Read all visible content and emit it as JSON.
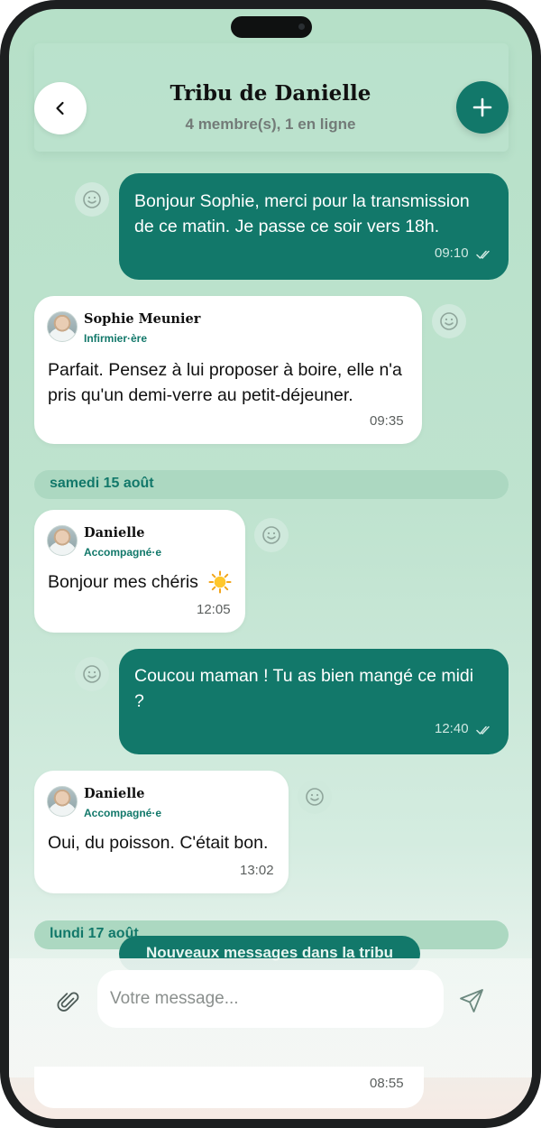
{
  "header": {
    "title": "Tribu de Danielle",
    "subtitle": "4 membre(s), 1 en ligne",
    "back_icon": "chevron-left-icon",
    "add_icon": "plus-icon"
  },
  "messages": [
    {
      "direction": "out",
      "text_lines": [
        "Bonjour Sophie, merci pour la transmission",
        "de ce matin. Je passe ce soir vers 18h."
      ],
      "time": "09:10",
      "read": true
    },
    {
      "direction": "in",
      "sender": "Sophie Meunier",
      "role": "Infirmier·ère",
      "text_lines": [
        "Parfait. Pensez à lui proposer à boire, elle n'a",
        "pris qu'un demi-verre au petit-déjeuner."
      ],
      "time": "09:35"
    },
    {
      "direction": "in",
      "sender": "Danielle",
      "role": "Accompagné·e",
      "text_lines": [
        "Bonjour mes chéris"
      ],
      "emoji": "sun",
      "time": "12:05"
    },
    {
      "direction": "out",
      "text_lines": [
        "Coucou maman ! Tu as bien mangé ce midi",
        "?"
      ],
      "time": "12:40",
      "read": true
    },
    {
      "direction": "in",
      "sender": "Danielle",
      "role": "Accompagné·e",
      "text_lines": [
        "Oui, du poisson. C'était bon."
      ],
      "time": "13:02"
    }
  ],
  "date_separators": [
    "samedi 15 août",
    "lundi 17 août"
  ],
  "new_messages_pill": "Nouveaux messages dans la tribu",
  "composer": {
    "placeholder": "Votre message...",
    "attach_icon": "paperclip-icon",
    "send_icon": "send-icon"
  },
  "last_message_time": "08:55",
  "colors": {
    "accent": "#12786a",
    "background": "#b6e0c8",
    "bubble_in": "#ffffff",
    "role_text": "#12786a"
  }
}
